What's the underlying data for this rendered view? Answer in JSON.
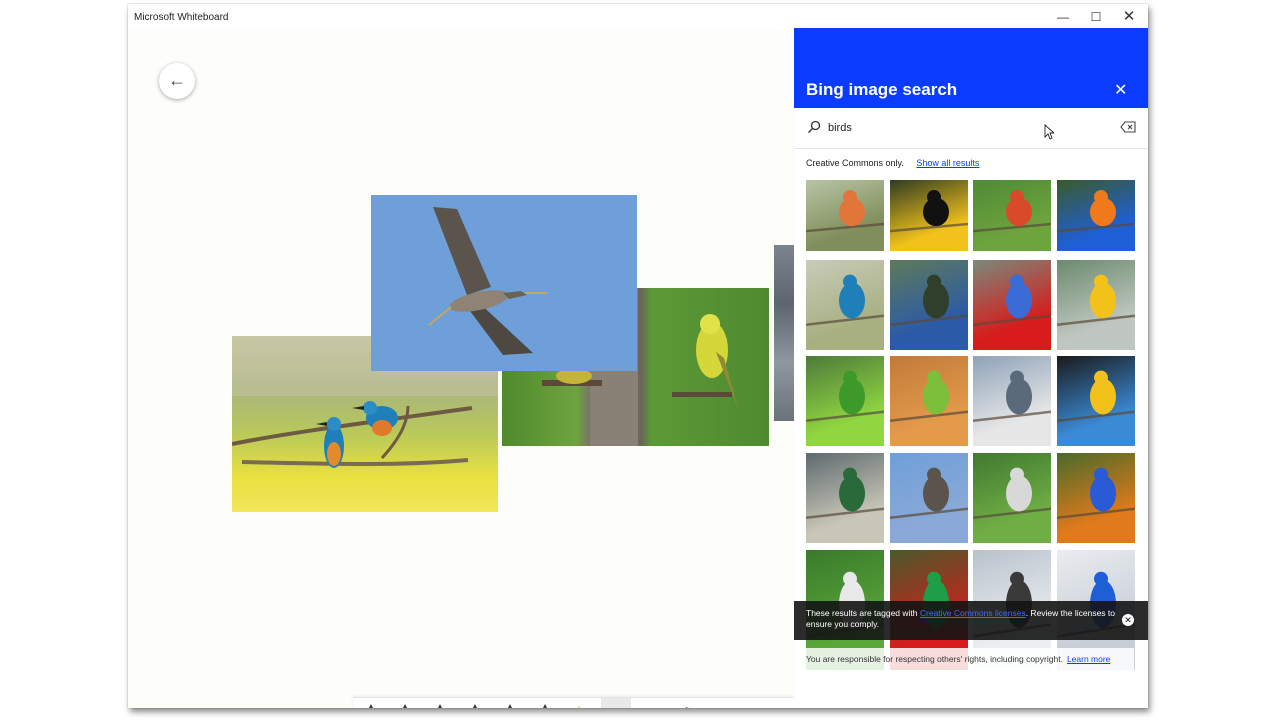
{
  "app": {
    "title": "Microsoft Whiteboard",
    "window_controls": {
      "minimize": "—",
      "maximize": "☐",
      "close": "✕"
    }
  },
  "canvas": {
    "back_glyph": "←",
    "images": [
      "kingfishers-on-branch",
      "birds-at-feeder",
      "heron-in-flight",
      "partial-image-edge"
    ]
  },
  "bing_panel": {
    "title": "Bing image search",
    "close_glyph": "✕",
    "search": {
      "value": "birds",
      "placeholder": ""
    },
    "filter_text": "Creative Commons only.",
    "show_all_link": "Show all results",
    "results": [
      "robin",
      "toucan",
      "bird-beak-closeup",
      "rainbow-lorikeet",
      "kingfisher",
      "blue-jay",
      "scarlet-macaws",
      "crowned-crane",
      "green-lovebirds",
      "orange-parakeet",
      "pelican",
      "macaw-face",
      "mallard-duck",
      "heron-flying",
      "bird-on-twig",
      "lorikeet-perched",
      "green-bird",
      "lorikeet-on-branch",
      "pelicans",
      "blue-bird"
    ],
    "toast": {
      "text_before": "These results are tagged with ",
      "link": "Creative Commons licenses",
      "text_after": ". Review the licenses to ensure you comply.",
      "close_glyph": "✕"
    },
    "notice": {
      "text": "You are responsible for respecting others' rights, including copyright.",
      "link": "Learn more"
    }
  },
  "toolbar": {
    "pens": [
      "#e0205a",
      "#d81b1b",
      "#1f5fd6",
      "#1f9e4a",
      "#e07a1b",
      "#1a7fd6",
      "#f2c21b",
      "#f09ab8"
    ],
    "tools": [
      "ruler-icon",
      "lasso-icon",
      "text-icon",
      "note-icon",
      "image-icon"
    ],
    "text_tool_glyph": "A"
  },
  "colors": {
    "panel_header": "#0a3bff",
    "link": "#0a3bff"
  }
}
